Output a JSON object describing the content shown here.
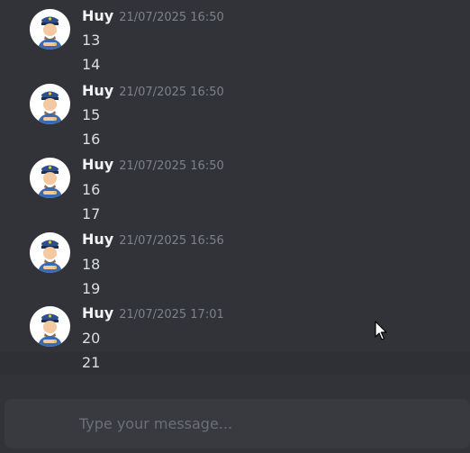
{
  "messages": [
    {
      "author": "Huy",
      "timestamp": "21/07/2025 16:50",
      "avatar_icon": "police-officer-avatar",
      "lines": [
        "13",
        "14"
      ]
    },
    {
      "author": "Huy",
      "timestamp": "21/07/2025 16:50",
      "avatar_icon": "police-officer-avatar",
      "lines": [
        "15",
        "16"
      ]
    },
    {
      "author": "Huy",
      "timestamp": "21/07/2025 16:50",
      "avatar_icon": "police-officer-avatar",
      "lines": [
        "16",
        "17"
      ]
    },
    {
      "author": "Huy",
      "timestamp": "21/07/2025 16:56",
      "avatar_icon": "police-officer-avatar",
      "lines": [
        "18",
        "19"
      ]
    },
    {
      "author": "Huy",
      "timestamp": "21/07/2025 17:01",
      "avatar_icon": "police-officer-avatar",
      "lines": [
        "20",
        "21"
      ]
    }
  ],
  "composer": {
    "placeholder": "Type your message..."
  },
  "colors": {
    "background": "#313338",
    "input_background": "#383a40",
    "author": "#f2f3f5",
    "timestamp": "#7d8188",
    "message_text": "#dbdee1",
    "hover_highlight": "#2e3035"
  }
}
